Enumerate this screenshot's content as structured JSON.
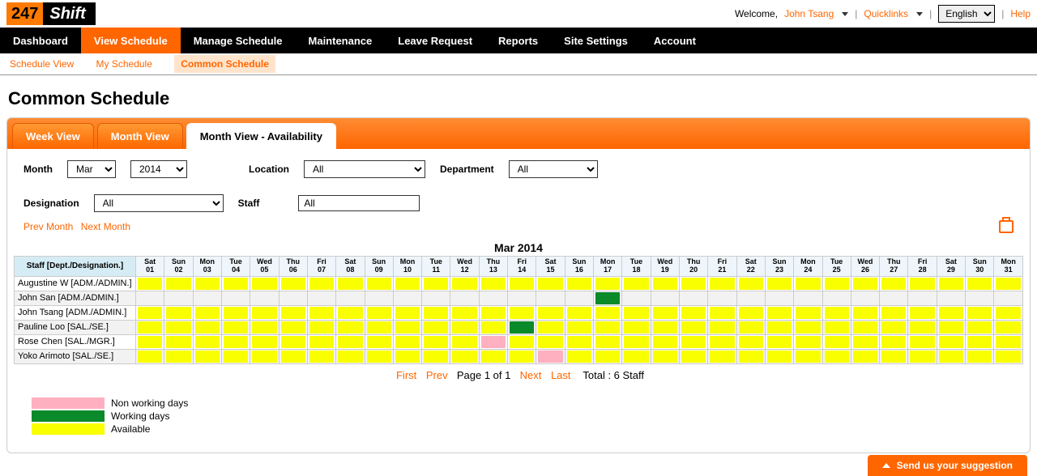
{
  "brand": {
    "p1": "247",
    "p2": "Shift"
  },
  "topbar": {
    "welcome": "Welcome,",
    "username": "John Tsang",
    "quicklinks": "Quicklinks",
    "language_options": [
      "English"
    ],
    "help": "Help"
  },
  "mainnav": [
    "Dashboard",
    "View Schedule",
    "Manage Schedule",
    "Maintenance",
    "Leave Request",
    "Reports",
    "Site Settings",
    "Account"
  ],
  "subnav": [
    "Schedule View",
    "My Schedule",
    "Common Schedule"
  ],
  "page_title": "Common Schedule",
  "tabs": [
    "Week View",
    "Month View",
    "Month View - Availability"
  ],
  "filters": {
    "month_label": "Month",
    "month_value": "Mar",
    "year_value": "2014",
    "location_label": "Location",
    "location_value": "All",
    "department_label": "Department",
    "department_value": "All",
    "designation_label": "Designation",
    "designation_value": "All",
    "staff_label": "Staff",
    "staff_value": "All"
  },
  "nav": {
    "prev": "Prev Month",
    "next": "Next Month"
  },
  "month_heading": "Mar 2014",
  "days": [
    {
      "dow": "Sat",
      "d": "01"
    },
    {
      "dow": "Sun",
      "d": "02"
    },
    {
      "dow": "Mon",
      "d": "03"
    },
    {
      "dow": "Tue",
      "d": "04"
    },
    {
      "dow": "Wed",
      "d": "05"
    },
    {
      "dow": "Thu",
      "d": "06"
    },
    {
      "dow": "Fri",
      "d": "07"
    },
    {
      "dow": "Sat",
      "d": "08"
    },
    {
      "dow": "Sun",
      "d": "09"
    },
    {
      "dow": "Mon",
      "d": "10"
    },
    {
      "dow": "Tue",
      "d": "11"
    },
    {
      "dow": "Wed",
      "d": "12"
    },
    {
      "dow": "Thu",
      "d": "13"
    },
    {
      "dow": "Fri",
      "d": "14"
    },
    {
      "dow": "Sat",
      "d": "15"
    },
    {
      "dow": "Sun",
      "d": "16"
    },
    {
      "dow": "Mon",
      "d": "17"
    },
    {
      "dow": "Tue",
      "d": "18"
    },
    {
      "dow": "Wed",
      "d": "19"
    },
    {
      "dow": "Thu",
      "d": "20"
    },
    {
      "dow": "Fri",
      "d": "21"
    },
    {
      "dow": "Sat",
      "d": "22"
    },
    {
      "dow": "Sun",
      "d": "23"
    },
    {
      "dow": "Mon",
      "d": "24"
    },
    {
      "dow": "Tue",
      "d": "25"
    },
    {
      "dow": "Wed",
      "d": "26"
    },
    {
      "dow": "Thu",
      "d": "27"
    },
    {
      "dow": "Fri",
      "d": "28"
    },
    {
      "dow": "Sat",
      "d": "29"
    },
    {
      "dow": "Sun",
      "d": "30"
    },
    {
      "dow": "Mon",
      "d": "31"
    }
  ],
  "staff_header": "Staff [Dept./Designation.]",
  "rows": [
    {
      "name": "Augustine W [ADM./ADMIN.]",
      "cells": [
        "y",
        "y",
        "y",
        "y",
        "y",
        "y",
        "y",
        "y",
        "y",
        "y",
        "y",
        "y",
        "y",
        "y",
        "y",
        "y",
        "y",
        "y",
        "y",
        "y",
        "y",
        "y",
        "y",
        "y",
        "y",
        "y",
        "y",
        "y",
        "y",
        "y",
        "y"
      ]
    },
    {
      "name": "John San [ADM./ADMIN.]",
      "cells": [
        "",
        "",
        "",
        "",
        "",
        "",
        "",
        "",
        "",
        "",
        "",
        "",
        "",
        "",
        "",
        "",
        "g",
        "",
        "",
        "",
        "",
        "",
        "",
        "",
        "",
        "",
        "",
        "",
        "",
        "",
        ""
      ]
    },
    {
      "name": "John Tsang [ADM./ADMIN.]",
      "cells": [
        "y",
        "y",
        "y",
        "y",
        "y",
        "y",
        "y",
        "y",
        "y",
        "y",
        "y",
        "y",
        "y",
        "y",
        "y",
        "y",
        "y",
        "y",
        "y",
        "y",
        "y",
        "y",
        "y",
        "y",
        "y",
        "y",
        "y",
        "y",
        "y",
        "y",
        "y"
      ]
    },
    {
      "name": "Pauline Loo [SAL./SE.]",
      "cells": [
        "y",
        "y",
        "y",
        "y",
        "y",
        "y",
        "y",
        "y",
        "y",
        "y",
        "y",
        "y",
        "y",
        "g",
        "y",
        "y",
        "y",
        "y",
        "y",
        "y",
        "y",
        "y",
        "y",
        "y",
        "y",
        "y",
        "y",
        "y",
        "y",
        "y",
        "y"
      ]
    },
    {
      "name": "Rose Chen [SAL./MGR.]",
      "cells": [
        "y",
        "y",
        "y",
        "y",
        "y",
        "y",
        "y",
        "y",
        "y",
        "y",
        "y",
        "y",
        "p",
        "y",
        "y",
        "y",
        "y",
        "y",
        "y",
        "y",
        "y",
        "y",
        "y",
        "y",
        "y",
        "y",
        "y",
        "y",
        "y",
        "y",
        "y"
      ]
    },
    {
      "name": "Yoko Arimoto [SAL./SE.]",
      "cells": [
        "y",
        "y",
        "y",
        "y",
        "y",
        "y",
        "y",
        "y",
        "y",
        "y",
        "y",
        "y",
        "y",
        "y",
        "p",
        "y",
        "y",
        "y",
        "y",
        "y",
        "y",
        "y",
        "y",
        "y",
        "y",
        "y",
        "y",
        "y",
        "y",
        "y",
        "y"
      ]
    }
  ],
  "pager": {
    "first": "First",
    "prev": "Prev",
    "page": "Page 1 of 1",
    "next": "Next",
    "last": "Last",
    "total": "Total : 6 Staff"
  },
  "legend": [
    {
      "color": "pink",
      "label": "Non working days"
    },
    {
      "color": "green",
      "label": "Working days"
    },
    {
      "color": "yellow",
      "label": "Available"
    }
  ],
  "suggest": "Send us your suggestion"
}
